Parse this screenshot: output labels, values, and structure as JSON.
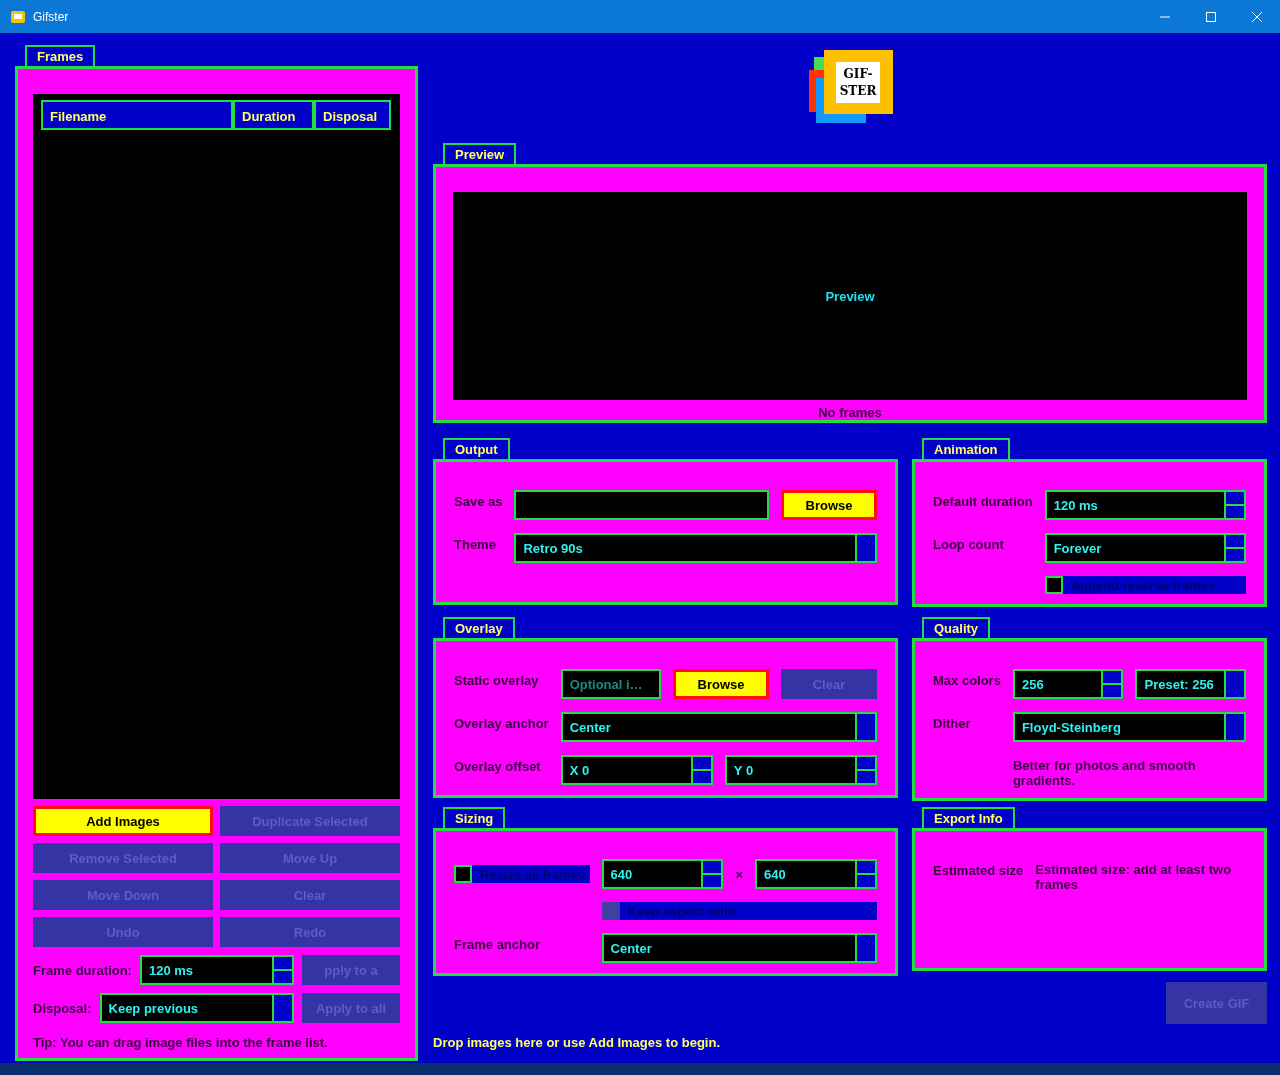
{
  "window": {
    "title": "Gifster"
  },
  "frames": {
    "title": "Frames",
    "columns": [
      "Filename",
      "Duration",
      "Disposal"
    ],
    "buttons": [
      {
        "label": "Add Images",
        "disabled": false
      },
      {
        "label": "Duplicate Selected",
        "disabled": true
      },
      {
        "label": "Remove Selected",
        "disabled": true
      },
      {
        "label": "Move Up",
        "disabled": true
      },
      {
        "label": "Move Down",
        "disabled": true
      },
      {
        "label": "Clear",
        "disabled": true
      },
      {
        "label": "Undo",
        "disabled": true
      },
      {
        "label": "Redo",
        "disabled": true
      }
    ],
    "settings": [
      {
        "label": "Frame duration:",
        "control": {
          "kind": "spin",
          "value": "120 ms"
        },
        "button": {
          "label": "pply to a",
          "disabled": true
        }
      },
      {
        "label": "Disposal:",
        "control": {
          "kind": "combo",
          "value": "Keep previous"
        },
        "button": {
          "label": "Apply to all",
          "disabled": true
        }
      }
    ],
    "tip": "Tip: You can drag image files into the frame list."
  },
  "logo": {
    "lines": [
      "GIF-",
      "STER"
    ]
  },
  "preview": {
    "title": "Preview",
    "placeholder": "Preview",
    "status": "No frames"
  },
  "groups": [
    {
      "title": "Output",
      "rows": [
        {
          "label": "Save as",
          "controls": [
            {
              "kind": "text"
            },
            {
              "kind": "button",
              "label": "Browse",
              "disabled": false
            }
          ]
        },
        {
          "label": "Theme",
          "controls": [
            {
              "kind": "combo",
              "value": "Retro 90s"
            }
          ]
        }
      ]
    },
    {
      "title": "Animation",
      "rows": [
        {
          "label": "Default duration",
          "controls": [
            {
              "kind": "spin",
              "value": "120 ms"
            }
          ]
        },
        {
          "label": "Loop count",
          "controls": [
            {
              "kind": "spin",
              "value": "Forever"
            }
          ]
        },
        {
          "controls": [
            {
              "kind": "checkbox",
              "label": "Append reverse frames",
              "checked": false,
              "disabled": false
            }
          ]
        }
      ]
    },
    {
      "title": "Overlay",
      "rows": [
        {
          "label": "Static overlay",
          "controls": [
            {
              "kind": "text",
              "placeholder": "Optional i…"
            },
            {
              "kind": "button",
              "label": "Browse",
              "disabled": false
            },
            {
              "kind": "button",
              "label": "Clear",
              "disabled": true
            }
          ]
        },
        {
          "label": "Overlay anchor",
          "controls": [
            {
              "kind": "combo",
              "value": "Center"
            }
          ]
        },
        {
          "label": "Overlay offset",
          "controls": [
            {
              "kind": "spin",
              "value": "X 0"
            },
            {
              "kind": "spin",
              "value": "Y 0"
            }
          ]
        }
      ]
    },
    {
      "title": "Quality",
      "rows": [
        {
          "label": "Max colors",
          "controls": [
            {
              "kind": "spin",
              "value": "256"
            },
            {
              "kind": "combo",
              "value": "Preset: 256"
            }
          ]
        },
        {
          "label": "Dither",
          "controls": [
            {
              "kind": "combo",
              "value": "Floyd-Steinberg"
            }
          ]
        },
        {
          "controls": [
            {
              "kind": "note",
              "text": "Better for photos and smooth gradients."
            }
          ]
        }
      ]
    },
    {
      "title": "Sizing",
      "rows": [
        {
          "lead": {
            "kind": "checkbox",
            "label": "Resize all frames",
            "checked": false,
            "disabled": false
          },
          "controls": [
            {
              "kind": "spin",
              "value": "640"
            },
            {
              "kind": "sign",
              "text": "×"
            },
            {
              "kind": "spin",
              "value": "640"
            }
          ]
        },
        {
          "controls": [
            {
              "kind": "checkbox",
              "label": "Keep aspect ratio",
              "checked": false,
              "disabled": true
            }
          ]
        },
        {
          "label": "Frame anchor",
          "controls": [
            {
              "kind": "combo",
              "value": "Center"
            }
          ]
        }
      ]
    },
    {
      "title": "Export Info",
      "rows": [
        {
          "label": "Estimated size",
          "controls": [
            {
              "kind": "note",
              "text": "Estimated size: add at least two frames"
            }
          ]
        }
      ]
    }
  ],
  "create_button": {
    "label": "Create GIF",
    "disabled": true
  },
  "status": "Drop images here or use Add Images to begin."
}
